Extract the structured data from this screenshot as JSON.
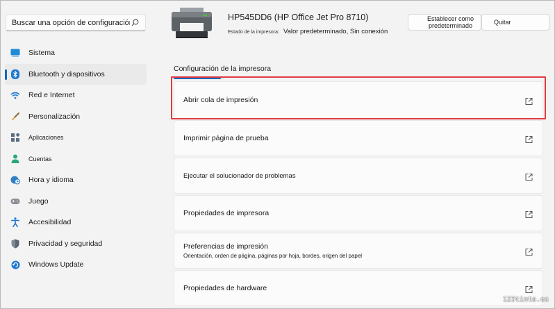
{
  "search": {
    "placeholder": "Buscar una opción de configuración"
  },
  "sidebar": {
    "items": [
      {
        "label": "Sistema",
        "icon": "monitor-icon"
      },
      {
        "label": "Bluetooth y dispositivos",
        "icon": "bluetooth-icon",
        "active": true
      },
      {
        "label": "Red e Internet",
        "icon": "wifi-icon"
      },
      {
        "label": "Personalización",
        "icon": "brush-icon"
      },
      {
        "label": "Aplicaciones",
        "icon": "apps-icon"
      },
      {
        "label": "Cuentas",
        "icon": "person-icon"
      },
      {
        "label": "Hora y idioma",
        "icon": "globe-clock-icon"
      },
      {
        "label": "Juego",
        "icon": "gamepad-icon"
      },
      {
        "label": "Accesibilidad",
        "icon": "accessibility-icon"
      },
      {
        "label": "Privacidad y seguridad",
        "icon": "shield-icon"
      },
      {
        "label": "Windows Update",
        "icon": "update-icon"
      }
    ]
  },
  "header": {
    "printer_name": "HP545DD6 (HP Office Jet Pro 8710)",
    "status_label": "Estado de la impresora:",
    "status_value": "Valor predeterminado, Sin conexión",
    "set_default_label": "Establecer como predeterminado",
    "quit_label": "Quitar"
  },
  "section": {
    "title": "Configuración de la impresora"
  },
  "cards": [
    {
      "label": "Abrir cola de impresión"
    },
    {
      "label": "Imprimir página de prueba"
    },
    {
      "label": "Ejecutar el solucionador de problemas"
    },
    {
      "label": "Propiedades de impresora"
    },
    {
      "label": "Preferencias de impresión",
      "sub": "Orientación, orden de página, páginas por hoja, bordes, origen del papel"
    },
    {
      "label": "Propiedades de hardware"
    }
  ],
  "watermark": "123tinta.es",
  "colors": {
    "accent": "#0067c0",
    "highlight": "#e03b42"
  }
}
